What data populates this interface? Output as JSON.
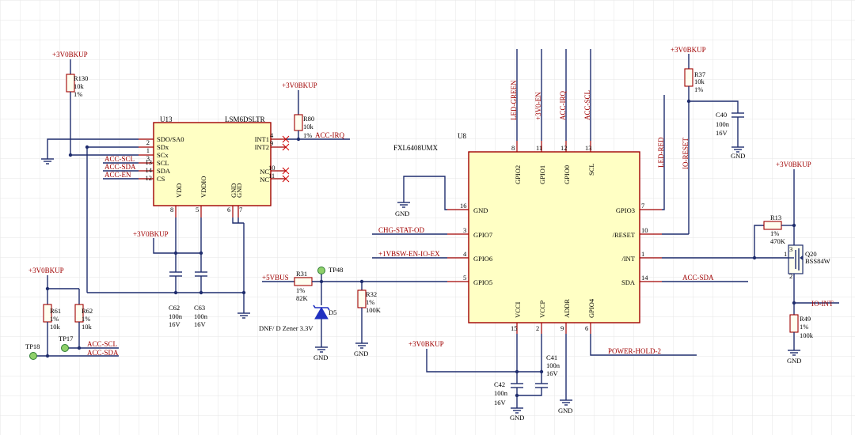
{
  "colors": {
    "wire": "#1f2d6e",
    "pin": "#a00000",
    "chip_fill": "#ffffc4",
    "label": "#a00000",
    "grid": "#e6e6e6",
    "zener": "#2030c0",
    "testpoint": "#3cb44b"
  },
  "u13": {
    "ref": "U13",
    "part": "LSM6DSLTR",
    "left_pins": [
      {
        "num": "2",
        "name": "SDO/SA0"
      },
      {
        "num": "1",
        "name": "SDx"
      },
      {
        "num": "3",
        "name": "SCx"
      },
      {
        "num": "13",
        "name": "SCL"
      },
      {
        "num": "14",
        "name": "SDA"
      },
      {
        "num": "12",
        "name": "CS"
      }
    ],
    "right_pins": [
      {
        "num": "4",
        "name": "INT1"
      },
      {
        "num": "9",
        "name": "INT2"
      },
      {
        "num": "10",
        "name": "NC"
      },
      {
        "num": "11",
        "name": "NC"
      }
    ],
    "bottom_pins": [
      {
        "num": "8",
        "name": "VDD"
      },
      {
        "num": "5",
        "name": "VDDIO"
      },
      {
        "num": "6",
        "name": "GND"
      },
      {
        "num": "7",
        "name": "GND"
      }
    ]
  },
  "u8": {
    "ref": "U8",
    "part": "FXL6408UMX",
    "top_pins": [
      {
        "num": "8",
        "name": "GPIO2"
      },
      {
        "num": "11",
        "name": "GPIO1"
      },
      {
        "num": "12",
        "name": "GPIO0"
      },
      {
        "num": "13",
        "name": "SCL"
      }
    ],
    "left_pins": [
      {
        "num": "16",
        "name": "GND"
      },
      {
        "num": "3",
        "name": "GPIO7"
      },
      {
        "num": "4",
        "name": "GPIO6"
      },
      {
        "num": "5",
        "name": "GPIO5"
      }
    ],
    "right_pins": [
      {
        "num": "7",
        "name": "GPIO3"
      },
      {
        "num": "10",
        "name": "/RESET"
      },
      {
        "num": "1",
        "name": "/INT"
      },
      {
        "num": "14",
        "name": "SDA"
      }
    ],
    "bottom_pins": [
      {
        "num": "15",
        "name": "VCCI"
      },
      {
        "num": "2",
        "name": "VCCP"
      },
      {
        "num": "9",
        "name": "ADDR"
      },
      {
        "num": "6",
        "name": "GPIO4"
      }
    ]
  },
  "resistors": {
    "r130": {
      "ref": "R130",
      "value": "10k",
      "tol": "1%"
    },
    "r80": {
      "ref": "R80",
      "value": "10k",
      "tol": "1%"
    },
    "r37": {
      "ref": "R37",
      "value": "10k",
      "tol": "1%"
    },
    "r61": {
      "ref": "R61",
      "value": "10k",
      "tol": "1%"
    },
    "r62": {
      "ref": "R62",
      "value": "10k",
      "tol": "1%"
    },
    "r31": {
      "ref": "R31",
      "value": "82K",
      "tol": "1%"
    },
    "r32": {
      "ref": "R32",
      "value": "100K",
      "tol": "1%"
    },
    "r13": {
      "ref": "R13",
      "value": "470K",
      "tol": "1%"
    },
    "r49": {
      "ref": "R49",
      "value": "100k",
      "tol": "1%"
    }
  },
  "capacitors": {
    "c62": {
      "ref": "C62",
      "value": "100n",
      "voltage": "16V"
    },
    "c63": {
      "ref": "C63",
      "value": "100n",
      "voltage": "16V"
    },
    "c40": {
      "ref": "C40",
      "value": "100n",
      "voltage": "16V"
    },
    "c41": {
      "ref": "C41",
      "value": "100n",
      "voltage": "16V"
    },
    "c42": {
      "ref": "C42",
      "value": "100n",
      "voltage": "16V"
    }
  },
  "q20": {
    "ref": "Q20",
    "part": "BSS84W",
    "pins": [
      "1",
      "2",
      "3"
    ]
  },
  "d5": {
    "ref": "D5",
    "desc": "DNF/ D Zener 3.3V"
  },
  "testpoints": {
    "tp18": "TP18",
    "tp17": "TP17",
    "tp48": "TP48"
  },
  "power": {
    "bkup": "+3V0BKUP",
    "vbus": "+5VBUS",
    "gnd": "GND"
  },
  "nets": {
    "acc_scl": "ACC-SCL",
    "acc_sda": "ACC-SDA",
    "acc_en": "ACC-EN",
    "acc_irq": "ACC-IRQ",
    "led_green": "LED-GREEN",
    "v3_en": "+3V0-EN",
    "led_red": "LED-RED",
    "io_reset": "IO-RESET",
    "chg_stat": "CHG-STAT-OD",
    "vbsw": "+1VBSW-EN-IO-EX",
    "power_hold": "POWER-HOLD-2",
    "io_int": "IO-INT"
  }
}
